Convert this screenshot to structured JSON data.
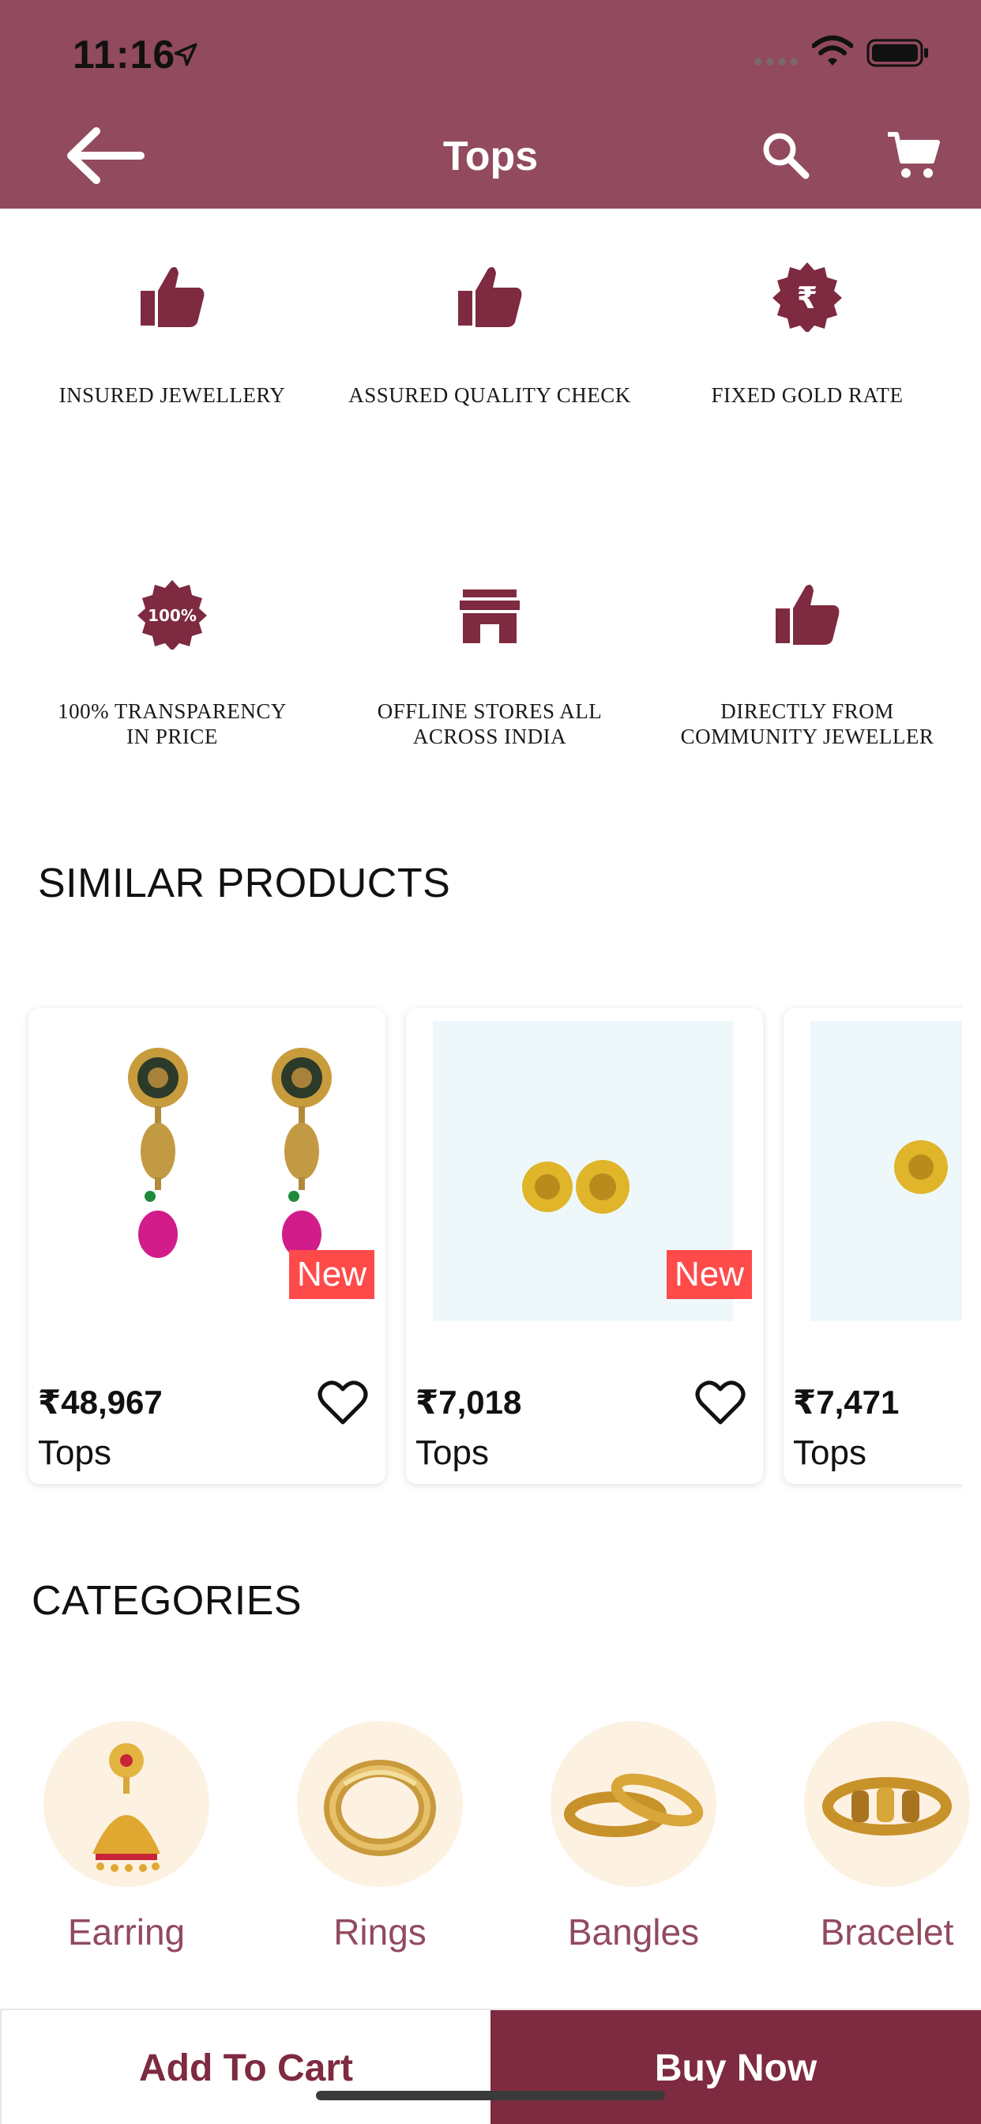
{
  "status_bar": {
    "time": "11:16"
  },
  "header": {
    "title": "Tops"
  },
  "features": [
    {
      "label": "INSURED JEWELLERY",
      "icon": "thumbs-up-icon"
    },
    {
      "label": "ASSURED QUALITY CHECK",
      "icon": "thumbs-up-icon"
    },
    {
      "label": "FIXED GOLD RATE",
      "icon": "rupee-badge-icon"
    },
    {
      "label": "100% TRANSPARENCY\nIN PRICE",
      "icon": "percent-badge-icon",
      "badge_text": "100%"
    },
    {
      "label": "OFFLINE STORES ALL\nACROSS INDIA",
      "icon": "store-icon"
    },
    {
      "label": "DIRECTLY FROM\nCOMMUNITY JEWELLER",
      "icon": "thumbs-up-icon"
    }
  ],
  "similar_products": {
    "title": "SIMILAR PRODUCTS",
    "items": [
      {
        "price": "₹48,967",
        "name": "Tops",
        "badge": "New"
      },
      {
        "price": "₹7,018",
        "name": "Tops",
        "badge": "New"
      },
      {
        "price": "₹7,471",
        "name": "Tops"
      }
    ]
  },
  "categories": {
    "title": "CATEGORIES",
    "items": [
      {
        "label": "Earring"
      },
      {
        "label": "Rings"
      },
      {
        "label": "Bangles"
      },
      {
        "label": "Bracelet"
      }
    ]
  },
  "actions": {
    "add_to_cart": "Add To Cart",
    "buy_now": "Buy Now"
  },
  "colors": {
    "brand": "#914a5e",
    "button": "#7e2a40",
    "badge": "#ff4a4a",
    "category_bg": "#fdf1e2"
  }
}
